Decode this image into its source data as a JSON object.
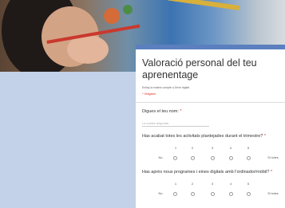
{
  "form": {
    "title": "Valoració personal del teu aprenentage",
    "description": "Enllaç la mateix compte a Drive digital",
    "required_note": "* Obligatori",
    "questions": [
      {
        "label": "Digues el teu nom:",
        "placeholder": "La vostra resposta"
      },
      {
        "label": "Has acabat totes les activitats plantejades durant el trimestre?",
        "scale": [
          "1",
          "2",
          "3",
          "4",
          "5"
        ],
        "low": "No",
        "high": "Sí totes"
      },
      {
        "label": "Has après nous programes i eines digitals amb l'ordinador/mòbil?",
        "scale": [
          "1",
          "2",
          "3",
          "4",
          "5"
        ],
        "low": "No",
        "high": "Sí totes"
      }
    ]
  }
}
